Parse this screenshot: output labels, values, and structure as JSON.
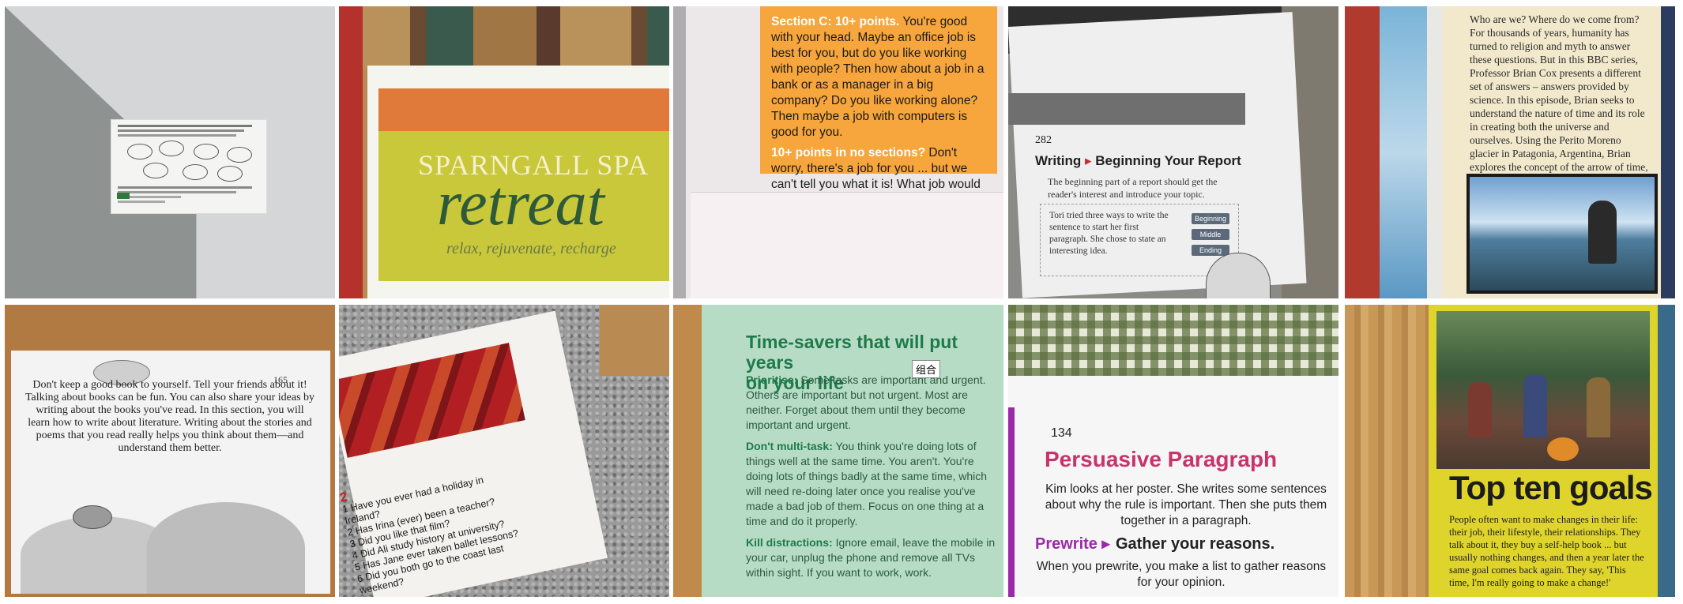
{
  "cells": {
    "c2": {
      "brand": "SPARNGALL SPA",
      "headline": "retreat",
      "tagline": "relax, rejuvenate, recharge"
    },
    "c3": {
      "section_c_label": "Section C: 10+ points.",
      "section_c_text": "You're good with your head. Maybe an office job is best for you, but do you like working with people? Then how about a job in a bank or as a manager in a big company? Do you like working alone? Then maybe a job with computers is good for you.",
      "no_section_label": "10+ points in no sections?",
      "no_section_text": "Don't worry, there's a job for you ... but we can't tell you what it is! What job would you like?"
    },
    "c4": {
      "page_number": "282",
      "title_a": "Writing",
      "title_b": "Beginning Your Report",
      "intro": "The beginning part of a report should get the reader's interest and introduce your topic.",
      "box_text": "Tori tried three ways to write the sentence to start her first paragraph. She chose to state an interesting idea.",
      "tags": [
        "Beginning",
        "Middle",
        "Ending"
      ]
    },
    "c5": {
      "text": "Who are we? Where do we come from? For thousands of years, humanity has turned to religion and myth to answer these questions. But in this BBC series, Professor Brian Cox presents a different set of answers – answers provided by science. In this episode, Brian seeks to understand the nature of time and its role in creating both the universe and ourselves. Using the Perito Moreno glacier in Patagonia, Argentina, Brian explores the concept of the arrow of time, characterised by irreversible change, and why sequences happen in the order they do."
    },
    "c6": {
      "page_number": "165",
      "text": "Don't keep a good book to yourself. Tell your friends about it! Talking about books can be fun. You can also share your ideas by writing about the books you've read. In this section, you will learn how to write about literature. Writing about the stories and poems that you read really helps you think about them—and understand them better."
    },
    "c7": {
      "number": "2",
      "items": [
        "1  Have you ever had a holiday in Ireland?",
        "2  Has Irina (ever) been a teacher?",
        "3  Did you like that film?",
        "4  Did Ali study history at university?",
        "5  Has Jane ever taken ballet lessons?",
        "6  Did you both go to the coast last weekend?"
      ]
    },
    "c8": {
      "title_line1": "Time-savers that will put years",
      "title_line2": "on your life",
      "p1_label": "Prioritise:",
      "p1_text": "Some tasks are important and urgent. Others are important but not urgent. Most are neither. Forget about them until they become important and urgent.",
      "p2_label": "Don't multi-task:",
      "p2_text": "You think you're doing lots of things well at the same time. You aren't. You're doing lots of things badly at the same time, which will need re-doing later once you realise you've made a bad job of them. Focus on one thing at a time and do it properly.",
      "p3_label": "Kill distractions:",
      "p3_text": "Ignore email, leave the mobile in your car, unplug the phone and remove all TVs within sight. If you want to work, work.",
      "tooltip": "组合"
    },
    "c9": {
      "page_number": "134",
      "title": "Persuasive Paragraph",
      "body": "Kim looks at her poster. She writes some sentences about why the rule is important. Then she puts them together in a paragraph.",
      "prewrite": "Prewrite ▸",
      "gather": "Gather your reasons.",
      "body2": "When you prewrite, you make a list to gather reasons for your opinion."
    },
    "c10": {
      "title": "Top ten goals",
      "body": "People often want to make changes in their life: their job, their lifestyle, their relationships. They talk about it, they buy a self-help book ... but usually nothing changes, and then a year later the same goal comes back again. They say, 'This time, I'm really going to make a change!'"
    }
  }
}
